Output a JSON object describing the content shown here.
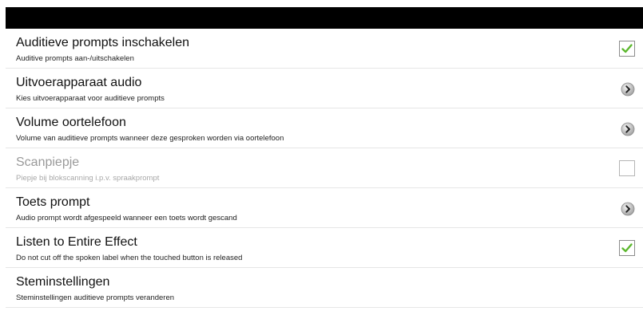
{
  "colors": {
    "check": "#5cb82e",
    "topbar": "#000000",
    "disabled_text": "#9a9a9a"
  },
  "settings": [
    {
      "title": "Auditieve prompts inschakelen",
      "subtitle": "Auditive prompts aan-/uitschakelen",
      "control": "checkbox",
      "checked": true,
      "enabled": true
    },
    {
      "title": "Uitvoerapparaat audio",
      "subtitle": "Kies uitvoerapparaat voor auditieve prompts",
      "control": "arrow",
      "enabled": true
    },
    {
      "title": "Volume oortelefoon",
      "subtitle": "Volume van auditieve prompts wanneer deze gesproken worden via oortelefoon",
      "control": "arrow",
      "enabled": true
    },
    {
      "title": "Scanpiepje",
      "subtitle": "Piepje bij blokscanning i.p.v. spraakprompt",
      "control": "checkbox",
      "checked": false,
      "enabled": false
    },
    {
      "title": "Toets prompt",
      "subtitle": "Audio prompt wordt afgespeeld wanneer een toets wordt gescand",
      "control": "arrow",
      "enabled": true
    },
    {
      "title": "Listen to Entire Effect",
      "subtitle": "Do not cut off the spoken label when the touched button is released",
      "control": "checkbox",
      "checked": true,
      "enabled": true
    },
    {
      "title": "Steminstellingen",
      "subtitle": "Steminstellingen auditieve prompts veranderen",
      "control": "none",
      "enabled": true
    }
  ]
}
